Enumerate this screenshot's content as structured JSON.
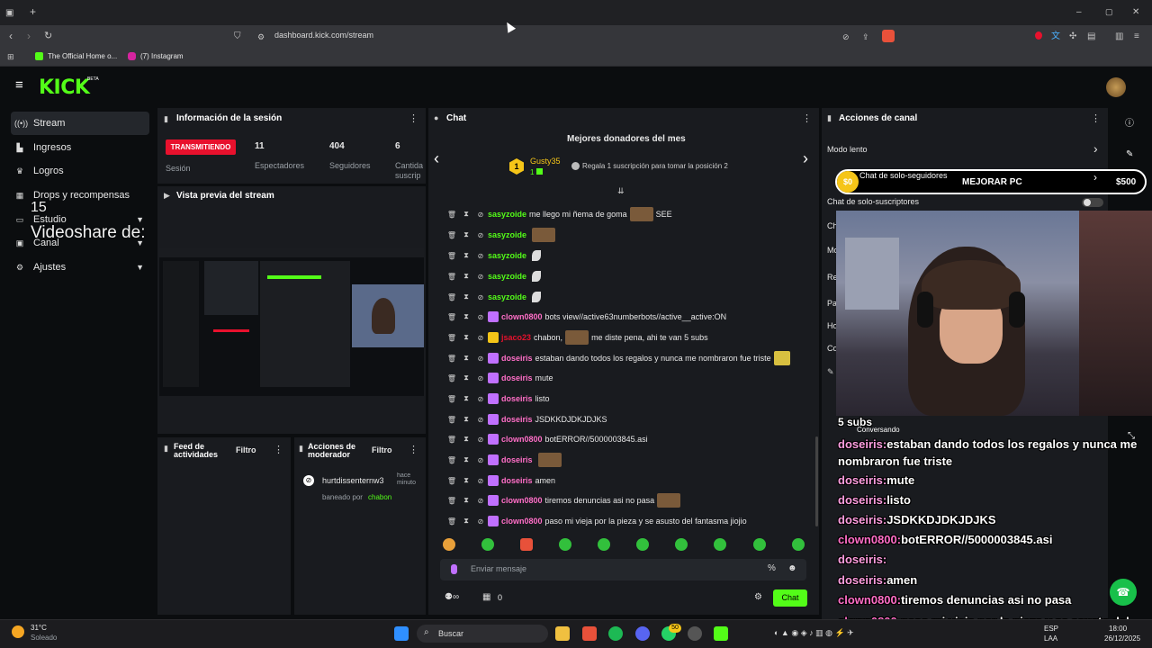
{
  "browser": {
    "url": "dashboard.kick.com/stream",
    "bookmarks": [
      "The Official Home o...",
      "(7) Instagram"
    ]
  },
  "sidebar": {
    "items": [
      {
        "label": "Stream",
        "icon": "radio-icon",
        "active": true
      },
      {
        "label": "Ingresos",
        "icon": "bank-icon"
      },
      {
        "label": "Logros",
        "icon": "trophy-icon"
      },
      {
        "label": "Drops y recompensas",
        "icon": "gift-icon"
      },
      {
        "label": "Estudio",
        "icon": "studio-icon"
      },
      {
        "label": "Canal",
        "icon": "channel-icon"
      },
      {
        "label": "Ajustes",
        "icon": "gear-icon"
      }
    ],
    "overlay_text_top": "15",
    "overlay_text": "Videoshare de:"
  },
  "session": {
    "title": "Información de la sesión",
    "live_badge": "TRANSMITIENDO",
    "session_label": "Sesión",
    "viewers": "11",
    "viewers_label": "Espectadores",
    "followers": "404",
    "followers_label": "Seguidores",
    "subs": "6",
    "subs_label": "Cantida suscrip"
  },
  "preview": {
    "title": "Vista previa del stream"
  },
  "activity": {
    "title": "Feed de actividades",
    "filter": "Filtro"
  },
  "modactions": {
    "title": "Acciones de moderador",
    "filter": "Filtro",
    "entry_user": "hurtdissenternw3",
    "entry_time": "hace minuto",
    "entry_action": "baneado por",
    "entry_mod": "chabon"
  },
  "chat": {
    "title": "Chat",
    "donors_title": "Mejores donadores del mes",
    "top_donor": "Gusty35",
    "top_donor_rank": "1",
    "top_donor_count": "1",
    "donor_cta": "Regala 1 suscripción para tomar la posición 2",
    "messages": [
      {
        "user": "sasyzoide",
        "color": "green",
        "text": "me llego mi ñema de goma",
        "suffix": "SEE"
      },
      {
        "user": "sasyzoide",
        "color": "green",
        "text": ""
      },
      {
        "user": "sasyzoide",
        "color": "green",
        "text": ""
      },
      {
        "user": "sasyzoide",
        "color": "green",
        "text": ""
      },
      {
        "user": "sasyzoide",
        "color": "green",
        "text": ""
      },
      {
        "user": "clown0800",
        "color": "pink",
        "text": "bots view//active63numberbots//active__active:ON"
      },
      {
        "user": "jsaco23",
        "color": "red",
        "text": "chabon,",
        "suffix": "me diste pena, ahi te van 5 subs"
      },
      {
        "user": "doseiris",
        "color": "pink",
        "text": "estaban dando todos los regalos y nunca me nombraron fue triste"
      },
      {
        "user": "doseiris",
        "color": "pink",
        "text": "mute"
      },
      {
        "user": "doseiris",
        "color": "pink",
        "text": "listo"
      },
      {
        "user": "doseiris",
        "color": "pink",
        "text": "JSDKKDJDKJDJKS"
      },
      {
        "user": "clown0800",
        "color": "pink",
        "text": "botERROR//5000003845.asi"
      },
      {
        "user": "doseiris",
        "color": "pink",
        "text": ""
      },
      {
        "user": "doseiris",
        "color": "pink",
        "text": "amen"
      },
      {
        "user": "clown0800",
        "color": "pink",
        "text": "tiremos denuncias asi no pasa"
      },
      {
        "user": "clown0800",
        "color": "pink",
        "text": "paso mi vieja por la pieza y se asusto del fantasma jiojio"
      }
    ],
    "input_placeholder": "Enviar mensaje",
    "viewers_count": "0",
    "send_label": "Chat"
  },
  "channel_actions": {
    "title": "Acciones de canal",
    "items": [
      "Modo lento",
      "Chat de solo-seguidores",
      "Chat de solo-suscriptores",
      "Ch",
      "Mo",
      "Re",
      "Pa",
      "Ho",
      "Co"
    ],
    "goal_current": "$0",
    "goal_label": "MEJORAR PC",
    "goal_target": "$500"
  },
  "overlay_chat": {
    "subs_text": "5 subs",
    "conversando": "Conversando",
    "lines": [
      {
        "user": "doseiris:",
        "text": "estaban dando todos los regalos y nunca me nombraron fue triste"
      },
      {
        "user": "doseiris:",
        "text": "mute"
      },
      {
        "user": "doseiris:",
        "text": "listo"
      },
      {
        "user": "doseiris:",
        "text": "JSDKKDJDKJDJKS"
      },
      {
        "user": "clown0800:",
        "text": "botERROR//5000003845.asi"
      },
      {
        "user": "doseiris:",
        "text": ""
      },
      {
        "user": "doseiris:",
        "text": "amen"
      },
      {
        "user": "clown0800:",
        "text": "tiremos denuncias asi no pasa"
      },
      {
        "user": "clown0800:",
        "text": "paso mi vieja por la pieza y se asusto del fantasma jiojio"
      }
    ]
  },
  "taskbar": {
    "weather_temp": "31°C",
    "weather_desc": "Soleado",
    "search": "Buscar",
    "lang": "ESP",
    "lang2": "LAA",
    "time": "18:00",
    "date": "26/12/2025",
    "badge_count": "50"
  },
  "colors": {
    "kick_green": "#53fc18",
    "live_red": "#e8112d",
    "pink": "#ff6ec7"
  }
}
